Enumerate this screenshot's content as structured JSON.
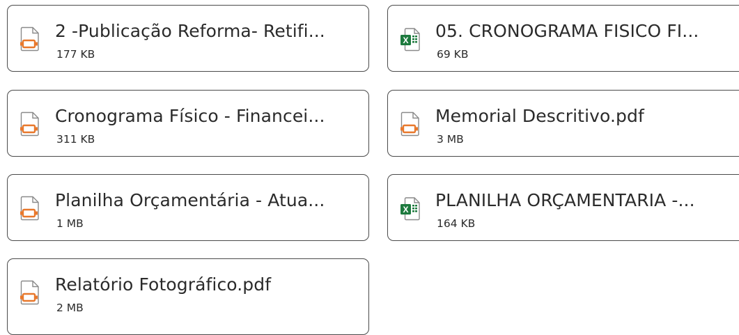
{
  "files": [
    {
      "name": "2 -Publicação Reforma- Retifi...",
      "size": "177 KB",
      "icon": "pdf-icon"
    },
    {
      "name": "05. CRONOGRAMA FISICO FI...",
      "size": "69 KB",
      "icon": "excel-icon"
    },
    {
      "name": "Cronograma Físico - Financei...",
      "size": "311 KB",
      "icon": "pdf-icon"
    },
    {
      "name": "Memorial Descritivo.pdf",
      "size": "3 MB",
      "icon": "pdf-icon"
    },
    {
      "name": "Planilha Orçamentária - Atua...",
      "size": "1 MB",
      "icon": "pdf-icon"
    },
    {
      "name": "PLANILHA ORÇAMENTARIA -...",
      "size": "164 KB",
      "icon": "excel-icon"
    },
    {
      "name": "Relatório Fotográfico.pdf",
      "size": "2 MB",
      "icon": "pdf-icon"
    }
  ],
  "colors": {
    "pdf_accent": "#e8782c",
    "excel_green": "#1d7a3e"
  }
}
